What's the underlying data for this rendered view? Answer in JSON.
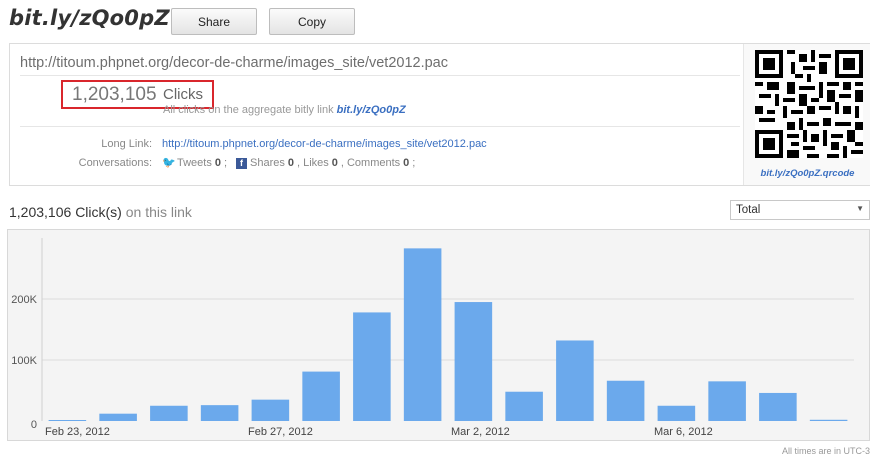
{
  "header": {
    "brand": "bit.ly/zQo0pZ",
    "share_label": "Share",
    "copy_label": "Copy"
  },
  "info": {
    "short_url": "http://titoum.phpnet.org/decor-de-charme/images_site/vet2012.pac",
    "clicks_count": "1,203,105",
    "clicks_word": "Clicks",
    "aggregate_text": "All clicks on the aggregate bitly link",
    "aggregate_link": "bit.ly/zQo0pZ",
    "long_link_label": "Long Link:",
    "long_link": "http://titoum.phpnet.org/decor-de-charme/images_site/vet2012.pac",
    "conversations_label": "Conversations:",
    "tweets_label": "Tweets",
    "tweets_count": "0",
    "shares_label": "Shares",
    "shares_count": "0",
    "likes_label": "Likes",
    "likes_count": "0",
    "comments_label": "Comments",
    "comments_count": "0",
    "qr_label": "bit.ly/zQo0pZ.qrcode"
  },
  "subhead": {
    "count": "1,203,106",
    "label": "Click(s)",
    "suffix": "on this link"
  },
  "range_select": {
    "selected": "Total"
  },
  "timezone_note": "All times are in UTC-3",
  "colors": {
    "bar": "#6ba9ec",
    "grid": "#dcdcdc",
    "link": "#3a6fc1",
    "highlight_box": "#d9262c"
  },
  "chart_data": {
    "type": "bar",
    "x_tick_labels": [
      "Feb 23, 2012",
      "Feb 27, 2012",
      "Mar 2, 2012",
      "Mar 6, 2012"
    ],
    "x_tick_positions": [
      0,
      4,
      8,
      12
    ],
    "categories": [
      "Feb 23",
      "Feb 24",
      "Feb 25",
      "Feb 26",
      "Feb 27",
      "Feb 28",
      "Feb 29",
      "Mar 1",
      "Mar 2",
      "Mar 3",
      "Mar 4",
      "Mar 5",
      "Mar 6",
      "Mar 7",
      "Mar 8",
      "Mar 9"
    ],
    "values": [
      1000,
      12000,
      25000,
      26000,
      35000,
      81000,
      178000,
      283000,
      195000,
      48000,
      132000,
      66000,
      25000,
      65000,
      46000,
      2000
    ],
    "y_ticks": [
      0,
      100000,
      200000
    ],
    "y_tick_labels": [
      "0",
      "100K",
      "200K"
    ],
    "ylim": [
      0,
      300000
    ],
    "grid": true
  }
}
